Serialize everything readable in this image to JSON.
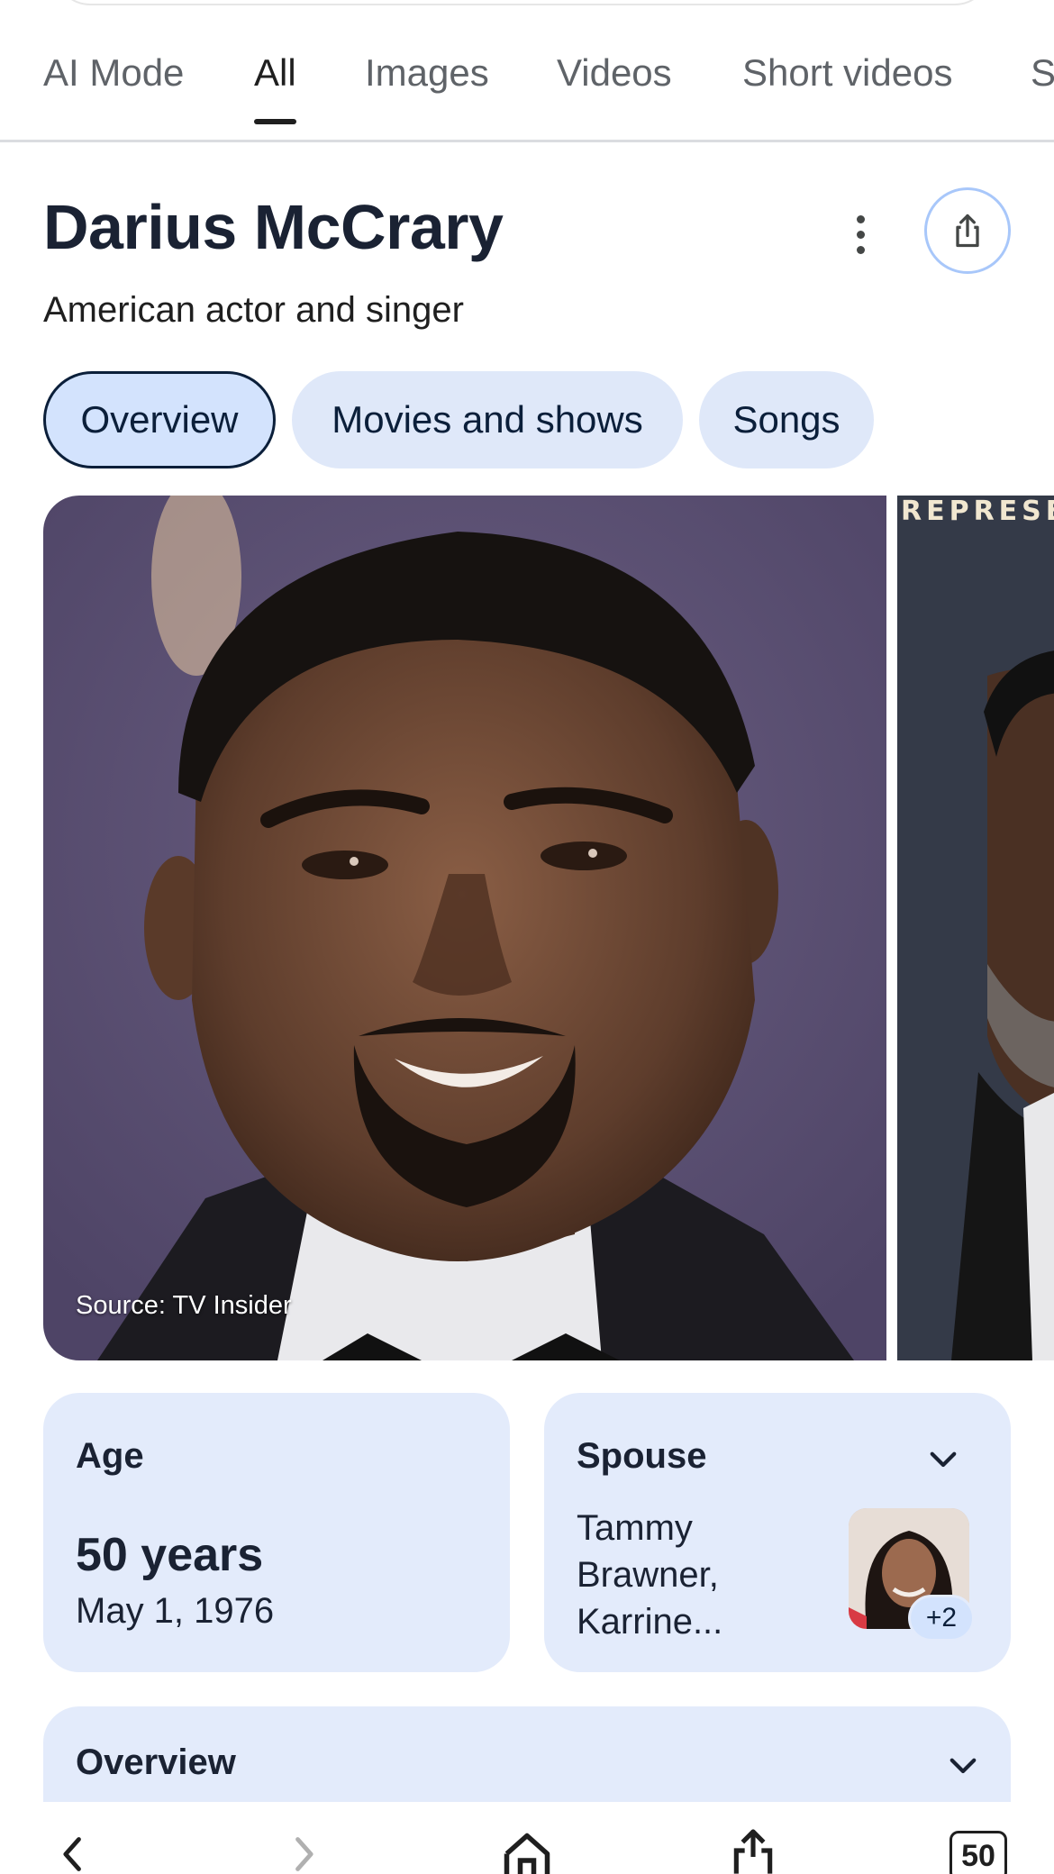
{
  "tabs": [
    {
      "label": "AI Mode"
    },
    {
      "label": "All"
    },
    {
      "label": "Images"
    },
    {
      "label": "Videos"
    },
    {
      "label": "Short videos"
    },
    {
      "label": "S"
    }
  ],
  "active_tab": "All",
  "entity": {
    "title": "Darius McCrary",
    "subtitle": "American actor and singer"
  },
  "chips": [
    {
      "label": "Overview"
    },
    {
      "label": "Movies and shows"
    },
    {
      "label": "Songs"
    }
  ],
  "active_chip": "Overview",
  "images": {
    "main_source": "Source: TV Insider",
    "second_overlay_text": "REPRESE"
  },
  "age_card": {
    "label": "Age",
    "value": "50 years",
    "date": "May 1, 1976"
  },
  "spouse_card": {
    "label": "Spouse",
    "names": "Tammy Brawner, Karrine...",
    "more_count": "+2"
  },
  "overview_card": {
    "label": "Overview"
  },
  "bottom_bar": {
    "tab_count": "50"
  },
  "colors": {
    "card_bg": "#e3ebfb",
    "chip_bg": "#dfe8f9",
    "active_chip_bg": "#d3e3fd",
    "title_color": "#1a2233",
    "share_ring": "#a8c7fa"
  }
}
